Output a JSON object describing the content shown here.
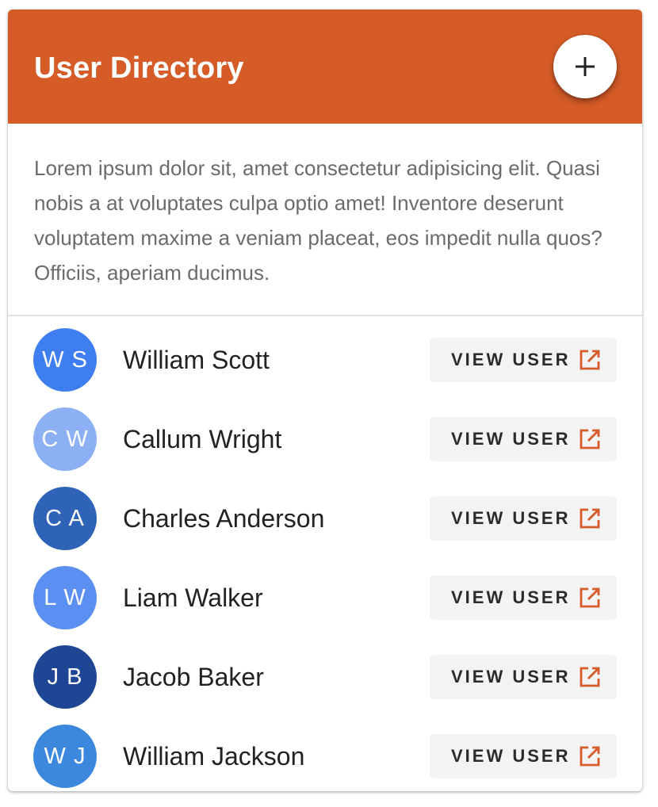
{
  "header": {
    "title": "User Directory",
    "add_icon": "plus-icon",
    "color": "#d55b27"
  },
  "description": "Lorem ipsum dolor sit, amet consectetur adipisicing elit. Quasi nobis a at voluptates culpa optio amet! Inventore deserunt voluptatem maxime a veniam placeat, eos impedit nulla quos? Officiis, aperiam ducimus.",
  "users": [
    {
      "initials": "W S",
      "name": "William Scott",
      "avatar_color": "#3f7ef0",
      "button_label": "VIEW USER",
      "button_icon": "open-in-new-icon"
    },
    {
      "initials": "C W",
      "name": "Callum Wright",
      "avatar_color": "#8db0f4",
      "button_label": "VIEW USER",
      "button_icon": "open-in-new-icon"
    },
    {
      "initials": "C A",
      "name": "Charles Anderson",
      "avatar_color": "#2f63b8",
      "button_label": "VIEW USER",
      "button_icon": "open-in-new-icon"
    },
    {
      "initials": "L W",
      "name": "Liam Walker",
      "avatar_color": "#5b8ff0",
      "button_label": "VIEW USER",
      "button_icon": "open-in-new-icon"
    },
    {
      "initials": "J B",
      "name": "Jacob Baker",
      "avatar_color": "#1f4595",
      "button_label": "VIEW USER",
      "button_icon": "open-in-new-icon"
    },
    {
      "initials": "W J",
      "name": "William Jackson",
      "avatar_color": "#3b88de",
      "button_label": "VIEW USER",
      "button_icon": "open-in-new-icon"
    }
  ],
  "accent_color": "#d55b27"
}
